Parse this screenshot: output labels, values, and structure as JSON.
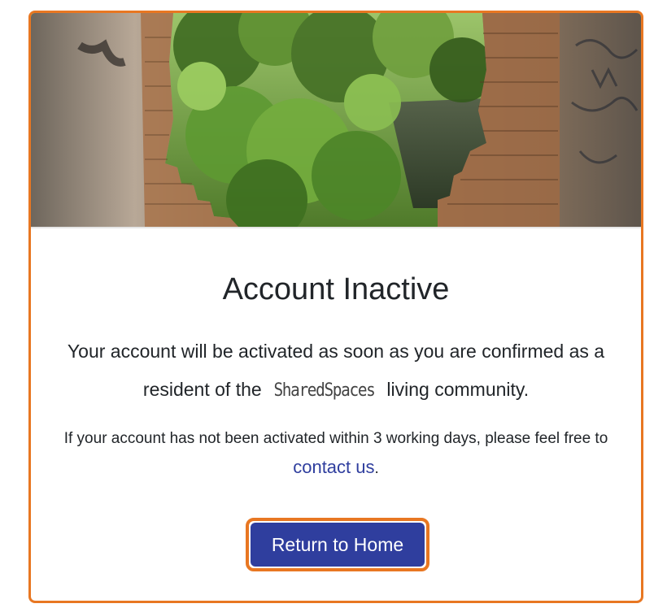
{
  "hero": {
    "image_alt": "Forest and river view through a broken brick wall"
  },
  "main": {
    "title": "Account Inactive",
    "lead_before": "Your account will be activated as soon as you are confirmed as a resident of the",
    "brand": "SharedSpaces",
    "lead_after": "living community.",
    "note_text": "If your account has not been activated within 3 working days, please feel free to",
    "contact_link": "contact us",
    "note_end": "."
  },
  "actions": {
    "return_home": "Return to Home"
  },
  "colors": {
    "accent_border": "#e87722",
    "primary": "#2f3e9e",
    "link": "#2f3e9e"
  }
}
